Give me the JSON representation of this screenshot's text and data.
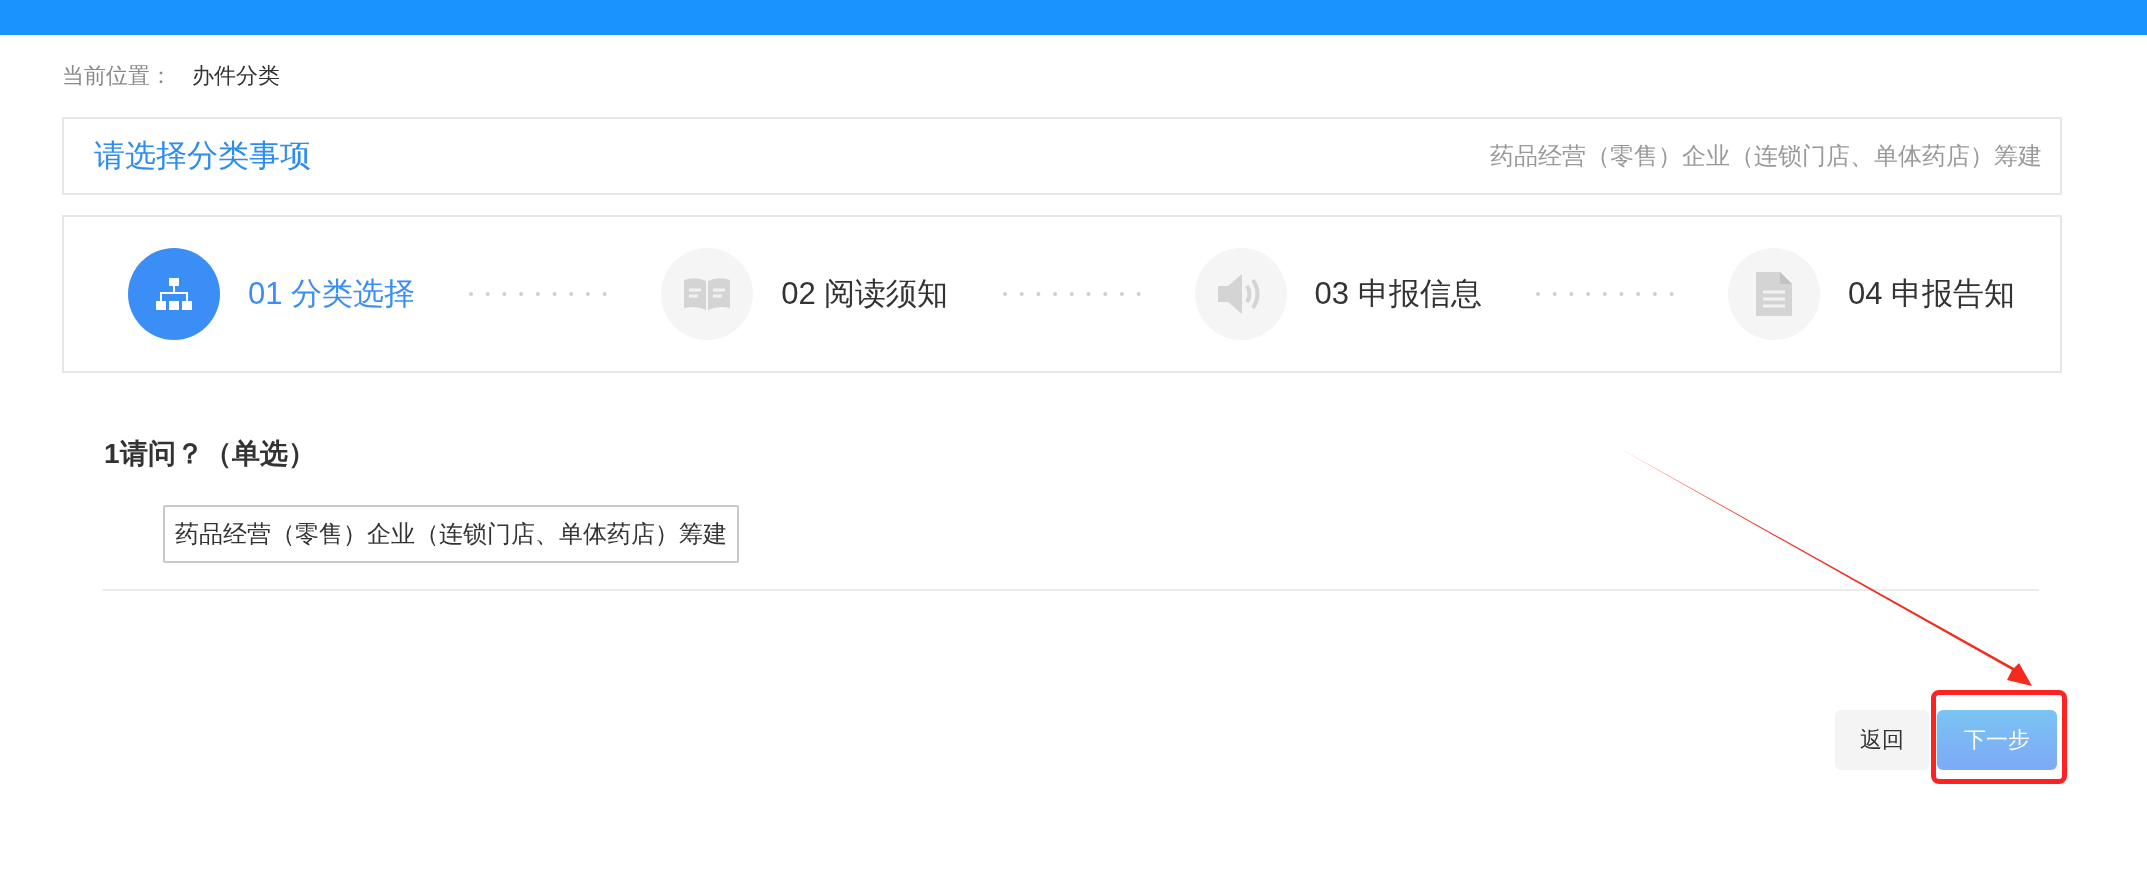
{
  "breadcrumb": {
    "label": "当前位置：",
    "current": "办件分类"
  },
  "header": {
    "title": "请选择分类事项",
    "selection": "药品经营（零售）企业（连锁门店、单体药店）筹建"
  },
  "steps": [
    {
      "label": "01 分类选择",
      "kind": "hierarchy",
      "selected": true
    },
    {
      "label": "02 阅读须知",
      "kind": "book",
      "selected": false
    },
    {
      "label": "03 申报信息",
      "kind": "speaker",
      "selected": false
    },
    {
      "label": "04 申报告知",
      "kind": "document",
      "selected": false
    }
  ],
  "question": {
    "title": "1请问？（单选）",
    "options": [
      {
        "label": "药品经营（零售）企业（连锁门店、单体药店）筹建"
      }
    ]
  },
  "buttons": [
    {
      "label": "返回",
      "kind": "back"
    },
    {
      "label": "下一步",
      "kind": "next"
    }
  ]
}
